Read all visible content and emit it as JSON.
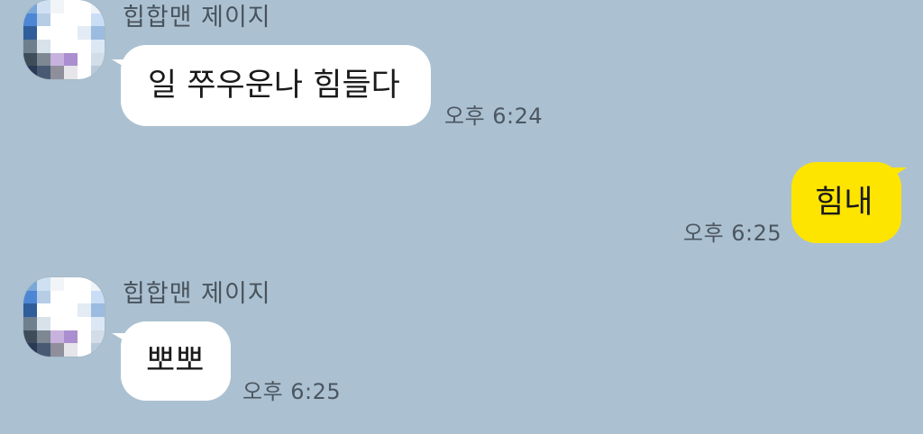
{
  "colors": {
    "background": "#abc1d1",
    "incoming_bubble": "#ffffff",
    "outgoing_bubble": "#fee500",
    "meta_text": "#4c5661"
  },
  "messages": [
    {
      "direction": "incoming",
      "sender": "힙합맨 제이지",
      "text": "일 쭈우운나 힘들다",
      "time": "오후 6:24"
    },
    {
      "direction": "outgoing",
      "text": "힘내",
      "time": "오후 6:25"
    },
    {
      "direction": "incoming",
      "sender": "힙합맨 제이지",
      "text": "뽀뽀",
      "time": "오후 6:25"
    }
  ],
  "avatar": {
    "icon": "pixelated-profile-avatar-icon",
    "pixels": [
      [
        "#7aa6d8",
        "#cfe0f2",
        "#f2f5f8",
        "#ffffff",
        "#ffffff",
        "#eef3fa"
      ],
      [
        "#4d86d4",
        "#b7cde6",
        "#ffffff",
        "#ffffff",
        "#ffffff",
        "#c9def5"
      ],
      [
        "#2f5e9a",
        "#ffffff",
        "#ffffff",
        "#ffffff",
        "#e3ebf4",
        "#9cbbe0"
      ],
      [
        "#6e7f8d",
        "#d8e2ea",
        "#ffffff",
        "#ffffff",
        "#ffffff",
        "#dbe7f4"
      ],
      [
        "#3e4c59",
        "#7d8893",
        "#c7b2dd",
        "#ab8ed0",
        "#ffffff",
        "#d2dde8"
      ],
      [
        "#2a3a56",
        "#485a73",
        "#8f8f9c",
        "#e5e5ea",
        "#ffffff",
        "#b8c9d9"
      ]
    ]
  }
}
